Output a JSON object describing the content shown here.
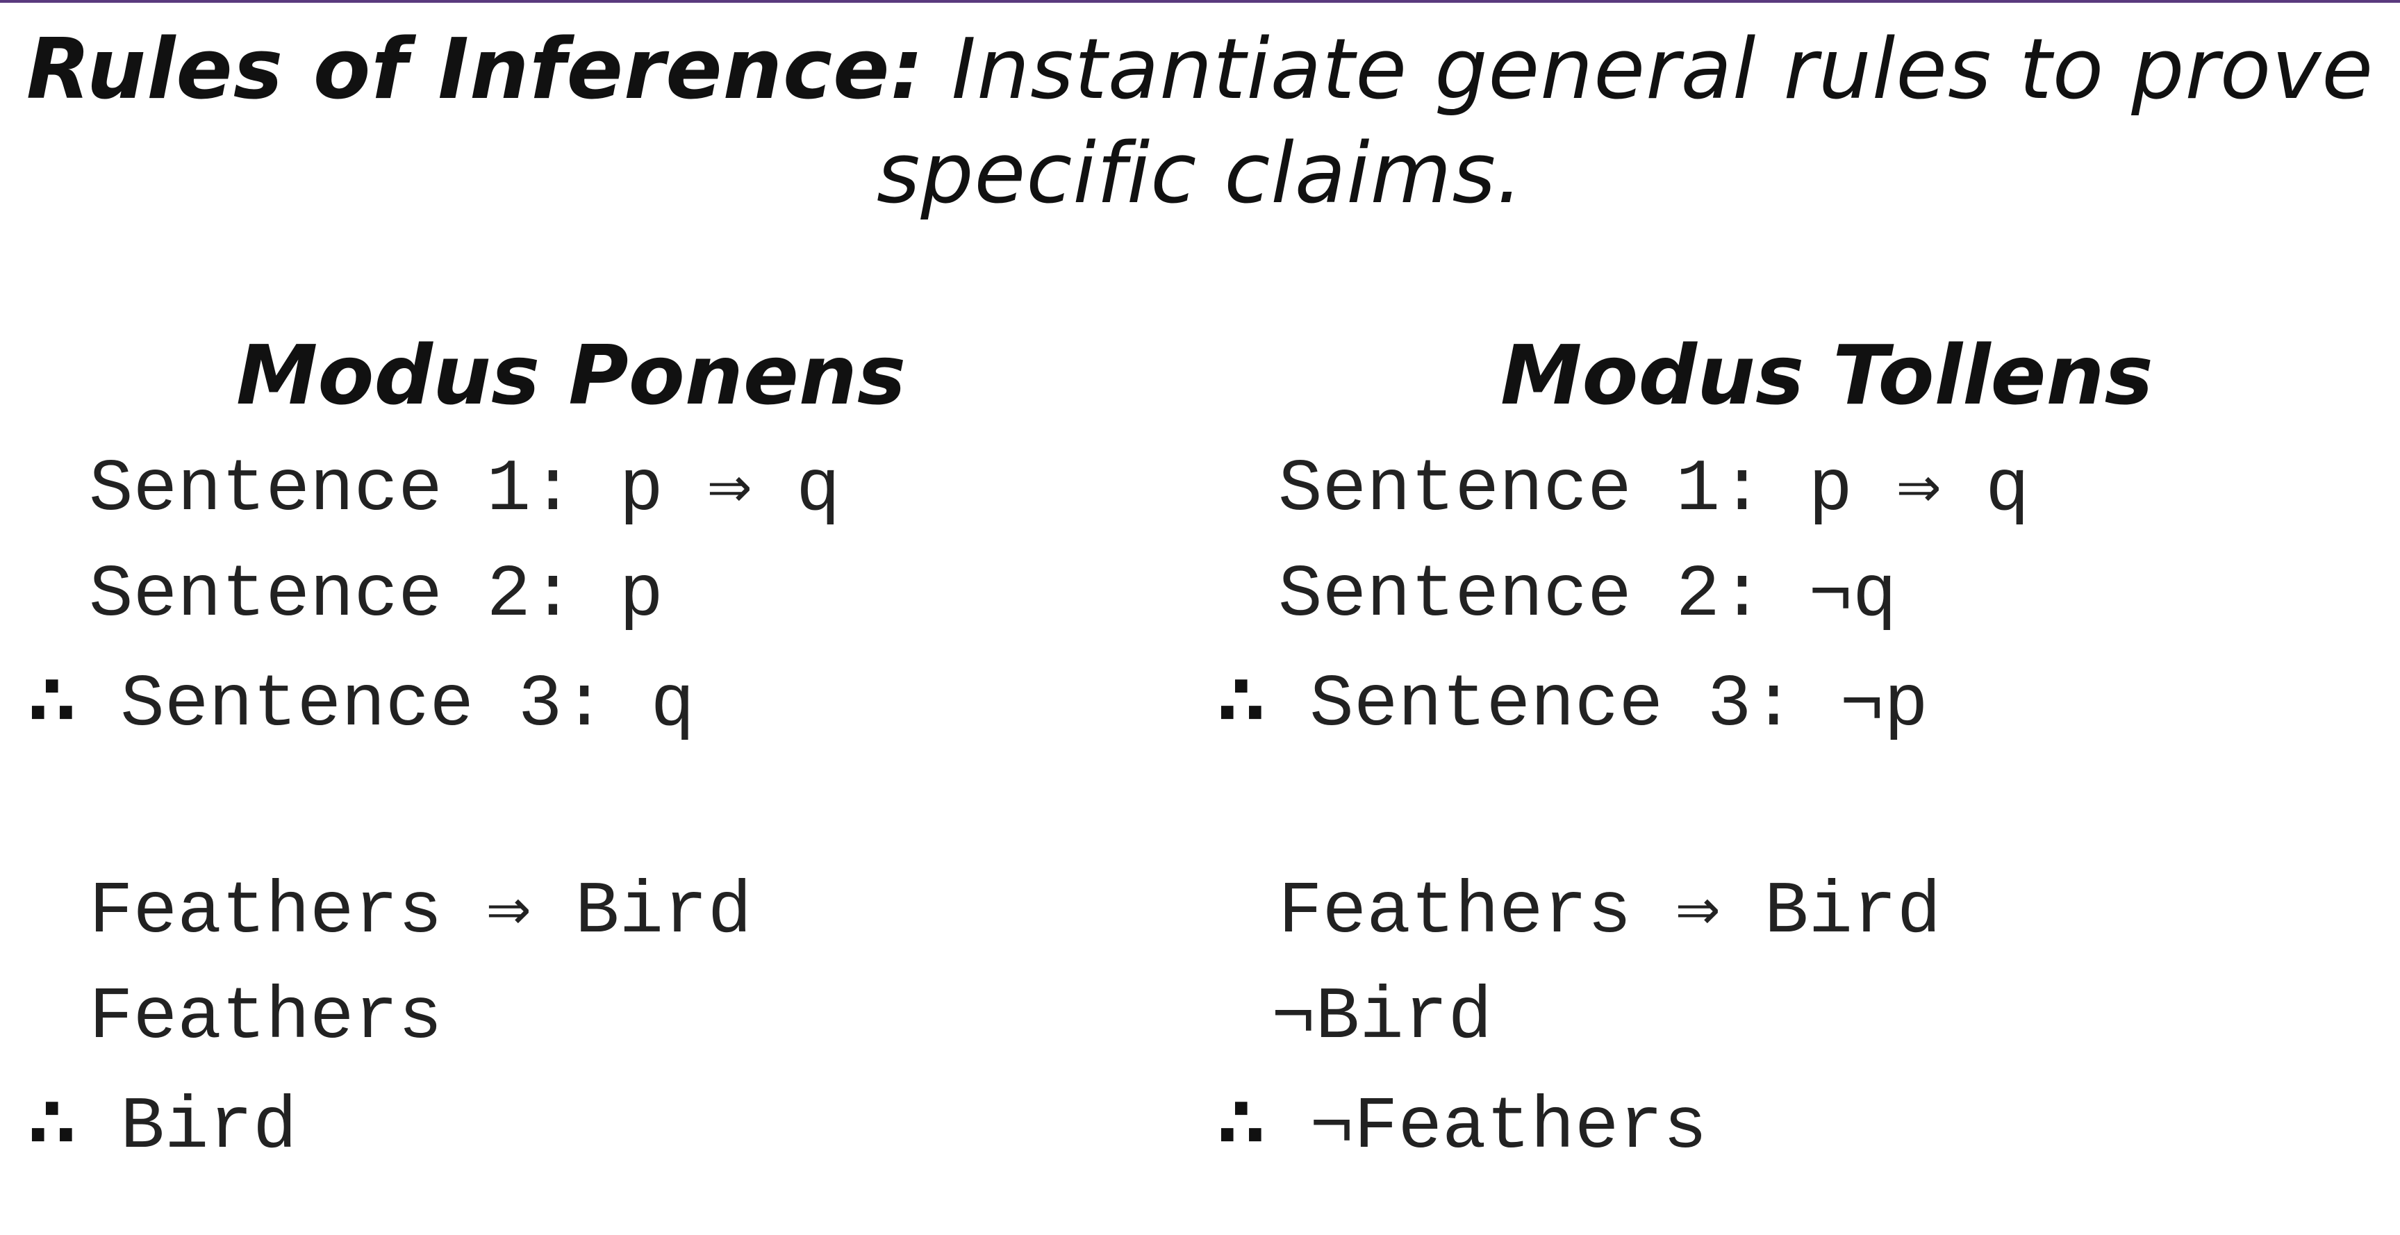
{
  "title": {
    "bold": "Rules of Inference:",
    "rest": "Instantiate general rules to prove specific claims."
  },
  "modus_ponens": {
    "heading": "Modus Ponens",
    "therefore_symbol": "∴",
    "lines": [
      "Sentence 1: p ⇒ q",
      "Sentence 2: p",
      "Sentence 3: q",
      "Feathers ⇒ Bird",
      "Feathers",
      "Bird"
    ]
  },
  "modus_tollens": {
    "heading": "Modus Tollens",
    "therefore_symbol": "∴",
    "lines": [
      "Sentence 1: p ⇒ q",
      "Sentence 2: ¬q",
      "Sentence 3: ¬p",
      "Feathers ⇒ Bird",
      "¬Bird",
      "¬Feathers"
    ]
  },
  "colors": {
    "accent_rule": "#5a3a7e",
    "text": "#111111"
  }
}
